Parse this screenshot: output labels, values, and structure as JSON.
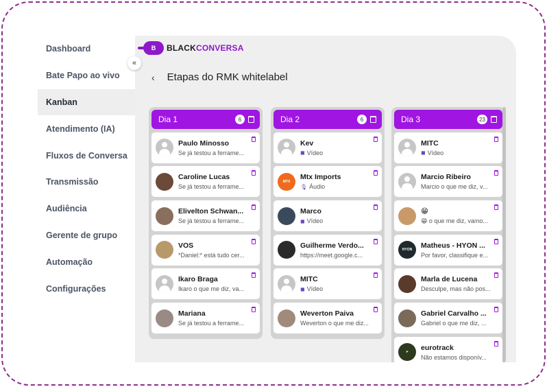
{
  "sidebar": {
    "items": [
      {
        "label": "Dashboard"
      },
      {
        "label": "Bate Papo ao vivo"
      },
      {
        "label": "Kanban",
        "active": true
      },
      {
        "label": "Atendimento (IA)"
      },
      {
        "label": "Fluxos de Conversa"
      },
      {
        "label": "Transmissão"
      },
      {
        "label": "Audiência"
      },
      {
        "label": "Gerente de grupo"
      },
      {
        "label": "Automação"
      },
      {
        "label": "Configurações"
      }
    ],
    "collapse_icon": "«"
  },
  "logo": {
    "mark": "B",
    "black": "BLACK",
    "conversa": "CONVERSA"
  },
  "header": {
    "back_icon": "‹",
    "title": "Etapas do RMK whitelabel"
  },
  "colors": {
    "accent": "#a015e2",
    "brand": "#8d1ac9"
  },
  "columns": [
    {
      "title": "Dia 1",
      "count": "6",
      "cards": [
        {
          "name": "Paulo Minosso",
          "message": "Se já testou a ferrame...",
          "avatar": "generic"
        },
        {
          "name": "Caroline Lucas",
          "message": "Se já testou a ferrame...",
          "avatar": "photo",
          "color": "#6b4a3a"
        },
        {
          "name": "Elivelton Schwan...",
          "message": "Se já testou a ferrame...",
          "avatar": "photo",
          "color": "#8a6f5e"
        },
        {
          "name": "VOS",
          "message": "*Daniel:* está tudo cer...",
          "avatar": "photo",
          "color": "#b89a6a"
        },
        {
          "name": "Ikaro Braga",
          "message": "Ikaro o que me diz, va...",
          "avatar": "generic"
        },
        {
          "name": "Mariana",
          "message": "Se já testou a ferrame...",
          "avatar": "photo",
          "color": "#9a8a86"
        }
      ]
    },
    {
      "title": "Dia 2",
      "count": "6",
      "cards": [
        {
          "name": "Kev",
          "message": "Vídeo",
          "icon": "video-icon",
          "glyph": "◼",
          "avatar": "generic"
        },
        {
          "name": "Mtx Imports",
          "message": "Áudio",
          "icon": "microphone-icon",
          "glyph": "🎙",
          "avatar": "logo",
          "color": "#f06a1d",
          "avatar_text": "MTX"
        },
        {
          "name": "Marco",
          "message": "Vídeo",
          "icon": "video-icon",
          "glyph": "◼",
          "avatar": "photo",
          "color": "#3a4a5a"
        },
        {
          "name": "Guilherme Verdo...",
          "message": "https://meet.google.c...",
          "avatar": "photo",
          "color": "#2a2a2a"
        },
        {
          "name": "MITC",
          "message": "Vídeo",
          "icon": "video-icon",
          "glyph": "◼",
          "avatar": "generic"
        },
        {
          "name": "Weverton Paiva",
          "message": "Weverton o que me diz...",
          "avatar": "photo",
          "color": "#a08a7a"
        }
      ]
    },
    {
      "title": "Dia 3",
      "count": "23",
      "cards": [
        {
          "name": "MITC",
          "message": "Vídeo",
          "icon": "video-icon",
          "glyph": "◼",
          "avatar": "generic"
        },
        {
          "name": "Marcio Ribeiro",
          "message": "Marcio o que me diz, v...",
          "avatar": "generic"
        },
        {
          "name": "😁",
          "message": "😁 o que me diz, vamo...",
          "avatar": "photo",
          "color": "#c89a6a"
        },
        {
          "name": "Matheus - HYON ...",
          "message": "Por favor, classifique e...",
          "avatar": "logo",
          "color": "#1e2a2e",
          "avatar_text": "HYON"
        },
        {
          "name": "Marla de Lucena",
          "message": "Desculpe, mas não pos...",
          "avatar": "photo",
          "color": "#5a3a2a"
        },
        {
          "name": "Gabriel Carvalho ...",
          "message": "Gabriel o que me diz, ...",
          "avatar": "photo",
          "color": "#7a6a5a"
        },
        {
          "name": "eurotrack",
          "message": "Não estamos disponív...",
          "avatar": "logo",
          "color": "#2d3a1e",
          "avatar_text": "➤"
        }
      ]
    }
  ]
}
